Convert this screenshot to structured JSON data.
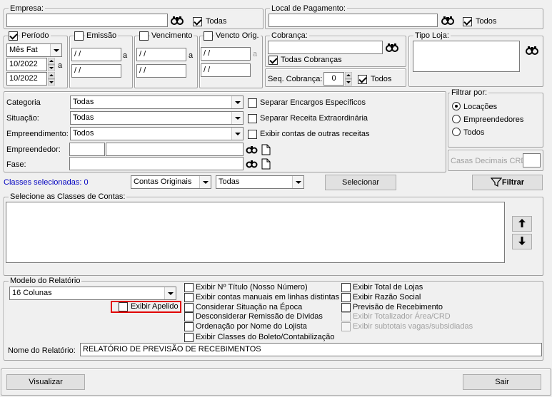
{
  "empresa": {
    "legend": "Empresa:",
    "value": "",
    "todas_label": "Todas"
  },
  "local_pagamento": {
    "legend": "Local de Pagamento:",
    "value": "",
    "todos_label": "Todos"
  },
  "periodo": {
    "label": "Período",
    "tipo": "Mês Fat",
    "de": "10/2022",
    "ate": "10/2022",
    "a": "a"
  },
  "emissao": {
    "label": "Emissão",
    "de": " / /",
    "ate": " / /",
    "a": "a"
  },
  "vencimento": {
    "label": "Vencimento",
    "de": " / /",
    "ate": " / /",
    "a": "a"
  },
  "vencto_orig": {
    "label": "Vencto Orig.",
    "de": " / /",
    "ate": " / /",
    "a": "a"
  },
  "cobranca": {
    "legend": "Cobrança:",
    "value": "",
    "todas_label": "Todas Cobranças",
    "seq_label": "Seq. Cobrança:",
    "seq_value": "0",
    "seq_todos_label": "Todos"
  },
  "tipo_loja": {
    "legend": "Tipo Loja:"
  },
  "filtros": {
    "categoria_label": "Categoria",
    "categoria_value": "Todas",
    "situacao_label": "Situação:",
    "situacao_value": "Todas",
    "empreendimento_label": "Empreendimento:",
    "empreendimento_value": "Todos",
    "empreendedor_label": "Empreendedor:",
    "fase_label": "Fase:",
    "separar_encargos": "Separar Encargos Específicos",
    "separar_receita": "Separar Receita Extraordinária",
    "exibir_outras": "Exibir contas de outras receitas"
  },
  "filtrar_por": {
    "legend": "Filtrar por:",
    "options": [
      "Locações",
      "Empreendedores",
      "Todos"
    ]
  },
  "casas_decimais_label": "Casas Decimais CRD",
  "classes": {
    "selecionadas": "Classes selecionadas: 0",
    "combo1": "Contas Originais",
    "combo2": "Todas",
    "selecionar": "Selecionar",
    "filtrar": "Filtrar",
    "legend": "Selecione as Classes de Contas:"
  },
  "modelo": {
    "legend": "Modelo do Relatório",
    "value": "16 Colunas",
    "exibir_apelido": "Exibir Apelido"
  },
  "opcoes_col1": [
    "Exibir Nº Título (Nosso Número)",
    "Exibir contas manuais em linhas distintas",
    "Considerar Situação na Época",
    "Desconsiderar Remissão de Dívidas",
    "Ordenação por Nome do Lojista",
    "Exibir Classes do Boleto/Contabilização"
  ],
  "opcoes_col2": [
    "Exibir Total de Lojas",
    "Exibir Razão Social",
    "Previsão de Recebimento",
    "Exibir Totalizador Área/CRD",
    "Exibir subtotais vagas/subsidiadas"
  ],
  "nome_relatorio_label": "Nome do Relatório:",
  "nome_relatorio_value": "RELATÓRIO DE PREVISÃO DE RECEBIMENTOS",
  "visualizar": "Visualizar",
  "sair": "Sair",
  "colors": {
    "highlight": "#e00000",
    "link_blue": "#0000c0"
  }
}
